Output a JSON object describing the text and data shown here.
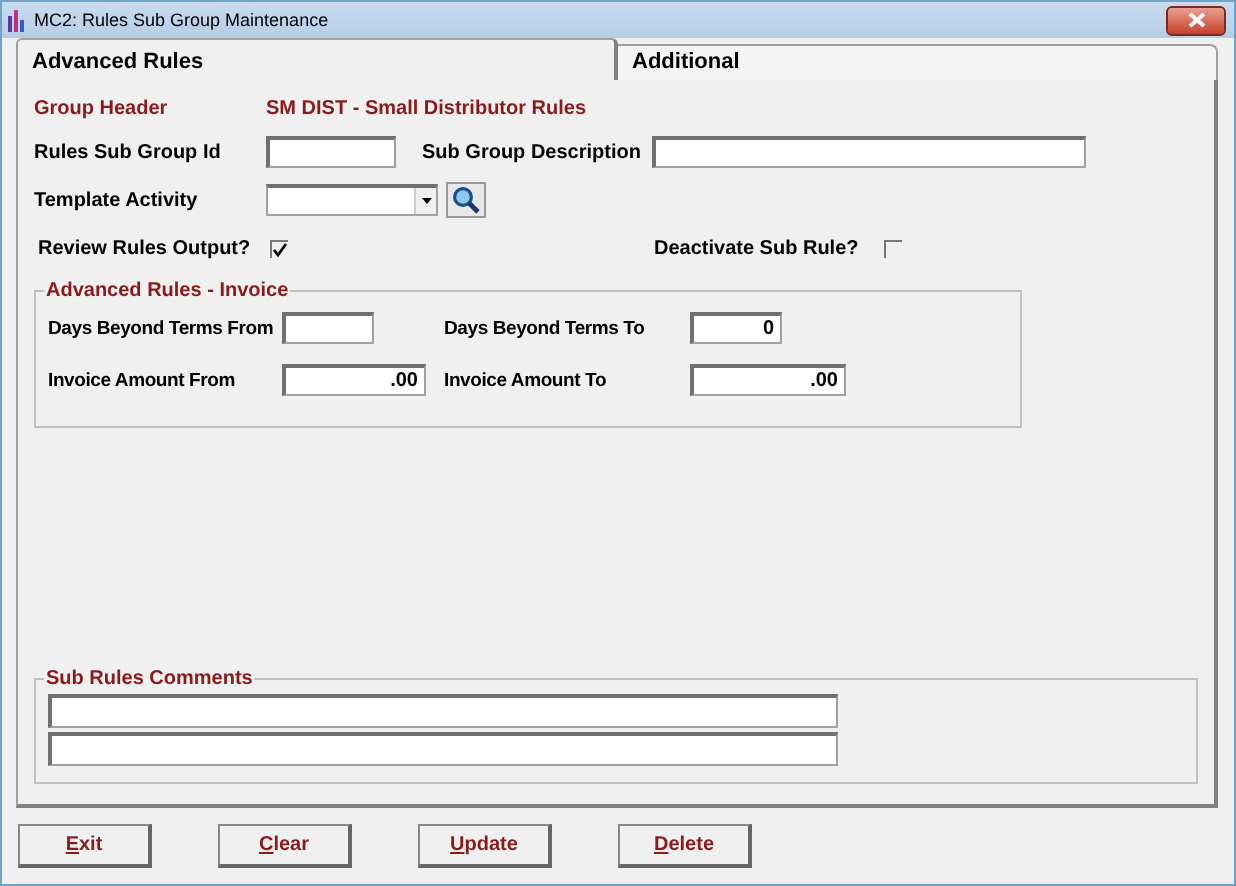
{
  "window": {
    "title": "MC2: Rules Sub Group Maintenance"
  },
  "tabs": [
    {
      "label": "Advanced Rules",
      "selected": true
    },
    {
      "label": "Additional",
      "selected": false
    }
  ],
  "group_header": {
    "label": "Group Header",
    "value": "SM DIST - Small Distributor Rules"
  },
  "rules_sub_group_id": {
    "label": "Rules Sub Group Id"
  },
  "sub_group_description": {
    "label": "Sub Group Description"
  },
  "template_activity": {
    "label": "Template Activity"
  },
  "review_rules_output": {
    "label": "Review Rules Output?",
    "checked": true
  },
  "deactivate_sub_rule": {
    "label": "Deactivate Sub Rule?",
    "checked": false
  },
  "invoice_group": {
    "title": "Advanced Rules - Invoice",
    "fields": [
      {
        "label": "Days Beyond Terms From"
      },
      {
        "label": "Days Beyond Terms To",
        "value": "0"
      },
      {
        "label": "Invoice Amount From",
        "value": ".00"
      },
      {
        "label": "Invoice Amount To",
        "value": ".00"
      }
    ]
  },
  "comments": {
    "title": "Sub Rules Comments"
  },
  "buttons": [
    "Exit",
    "Clear",
    "Update",
    "Delete"
  ]
}
